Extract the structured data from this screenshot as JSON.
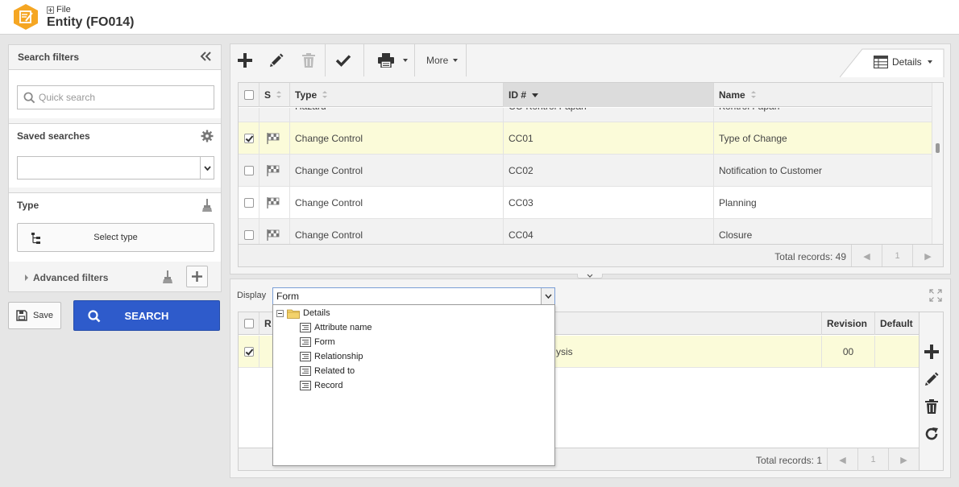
{
  "header": {
    "breadcrumb": "File",
    "title": "Entity (FO014)"
  },
  "search_filters": {
    "title": "Search filters",
    "quick_search_placeholder": "Quick search",
    "saved_searches_label": "Saved searches",
    "saved_searches_value": "",
    "type_label": "Type",
    "select_type_label": "Select type",
    "advanced_filters_label": "Advanced filters",
    "save_label": "Save",
    "search_label": "SEARCH"
  },
  "toolbar": {
    "more_label": "More",
    "details_label": "Details"
  },
  "main_grid": {
    "columns": {
      "s": "S",
      "type": "Type",
      "id": "ID #",
      "name": "Name"
    },
    "partial_row": {
      "type": "Hazard",
      "id": "CC-Kontrol Fapan",
      "name": "Kontrol Fapan"
    },
    "rows": [
      {
        "type": "Change Control",
        "id": "CC01",
        "name": "Type of Change",
        "checked": true
      },
      {
        "type": "Change Control",
        "id": "CC02",
        "name": "Notification to Customer",
        "checked": false
      },
      {
        "type": "Change Control",
        "id": "CC03",
        "name": "Planning",
        "checked": false
      },
      {
        "type": "Change Control",
        "id": "CC04",
        "name": "Closure",
        "checked": false
      }
    ],
    "total_records": "Total records: 49",
    "page": "1"
  },
  "detail_panel": {
    "display_label": "Display",
    "display_value": "Form",
    "columns": {
      "r": "R",
      "revision": "Revision",
      "default": "Default"
    },
    "row": {
      "name_fragment": "ysis",
      "revision": "00"
    },
    "total_records": "Total records: 1",
    "page": "1"
  },
  "display_tree": {
    "root": "Details",
    "children": [
      "Attribute name",
      "Form",
      "Relationship",
      "Related to",
      "Record"
    ]
  },
  "colors": {
    "accent_orange": "#f5a623",
    "search_blue": "#2e5bcb",
    "selected_row": "#fbfbd9"
  }
}
